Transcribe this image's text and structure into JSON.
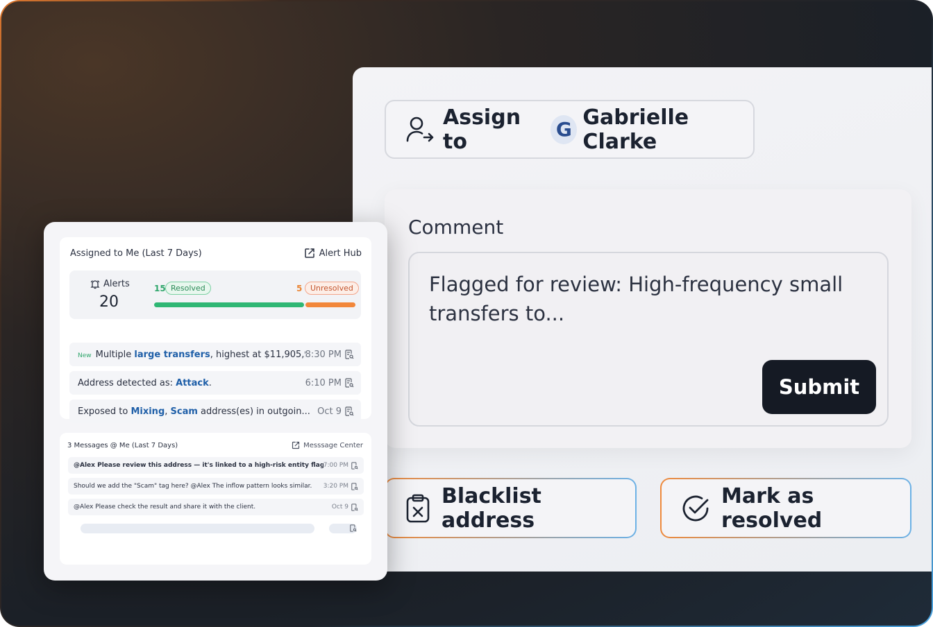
{
  "action_panel": {
    "assign": {
      "prefix": "Assign to",
      "avatar_initial": "G",
      "assignee_name": "Gabrielle Clarke",
      "icon": "user-arrow-icon"
    },
    "comment": {
      "title": "Comment",
      "value": "Flagged for review: High-frequency small transfers to...",
      "submit_label": "Submit"
    },
    "blacklist_label": "Blacklist address",
    "resolve_label": "Mark as resolved"
  },
  "dashboard": {
    "alerts_card": {
      "title": "Assigned to Me (Last 7 Days)",
      "hub_link": "Alert Hub",
      "alerts_label": "Alerts",
      "alerts_count": "20",
      "resolved_count": "15",
      "resolved_label": "Resolved",
      "unresolved_count": "5",
      "unresolved_label": "Unresolved",
      "resolved_fraction": 0.75,
      "colors": {
        "resolved": "#2fb774",
        "unresolved": "#f2873a"
      },
      "rows": [
        {
          "tag": "New",
          "pre": "Multiple ",
          "hl1": "large transfers",
          "post": ", highest at $11,905,9...",
          "time": "8:30 PM"
        },
        {
          "tag": "",
          "pre": "Address detected as: ",
          "hl1": "Attack",
          "post": ".",
          "time": "6:10 PM"
        },
        {
          "tag": "",
          "pre": "Exposed to ",
          "hl1": "Mixing",
          "sep": ", ",
          "hl2": "Scam",
          "post": " address(es) in outgoin...",
          "time": "Oct 9"
        }
      ]
    },
    "messages_card": {
      "title": "3 Messages @ Me (Last 7 Days)",
      "center_link": "Messsage Center",
      "rows": [
        {
          "text": "@Alex Please review this address — it's linked to a high-risk entity flagge...",
          "time": "7:00 PM"
        },
        {
          "text": "Should we add the \"Scam\" tag here? @Alex The inflow pattern looks similar.",
          "time": "3:20 PM"
        },
        {
          "text": "@Alex Please check the result and share it with the client.",
          "time": "Oct 9"
        }
      ]
    }
  }
}
